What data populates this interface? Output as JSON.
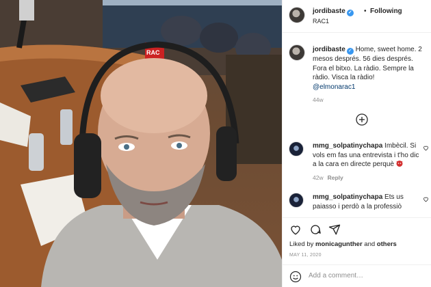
{
  "post": {
    "username": "jordibaste",
    "separator": "•",
    "following_label": "Following",
    "location": "RAC1",
    "caption_user": "jordibaste",
    "caption_text": "Home, sweet home. 2 mesos després. 56 dies després. Fora el bitxo. La ràdio. Sempre la ràdio. Visca la ràdio!",
    "caption_mention": "@elmonarac1",
    "caption_age": "44w"
  },
  "comments": [
    {
      "user": "mmg_solpatinychapa",
      "text": "Imbècil. Si vols em fas una entrevista i t'ho dic a la cara en directe perquè",
      "age": "42w",
      "reply_label": "Reply"
    },
    {
      "user": "mmg_solpatinychapa",
      "text": "Ets us paiasso i perdò a la professiò"
    }
  ],
  "actions": {
    "liked_prefix": "Liked by",
    "liked_user": "monicagunther",
    "liked_and": "and",
    "liked_others": "others",
    "date": "MAY 11, 2020",
    "add_comment_placeholder": "Add a comment…"
  },
  "photo": {
    "mic_flag_text": "RAC"
  },
  "icons": [
    "verified-badge-icon",
    "load-more-plus-icon",
    "heart-icon",
    "comment-icon",
    "share-icon",
    "emoji-icon"
  ],
  "colors": {
    "verified": "#3897f0",
    "mention": "#00376b",
    "muted": "#8e8e8e",
    "emoji_red": "#d32f2f"
  }
}
